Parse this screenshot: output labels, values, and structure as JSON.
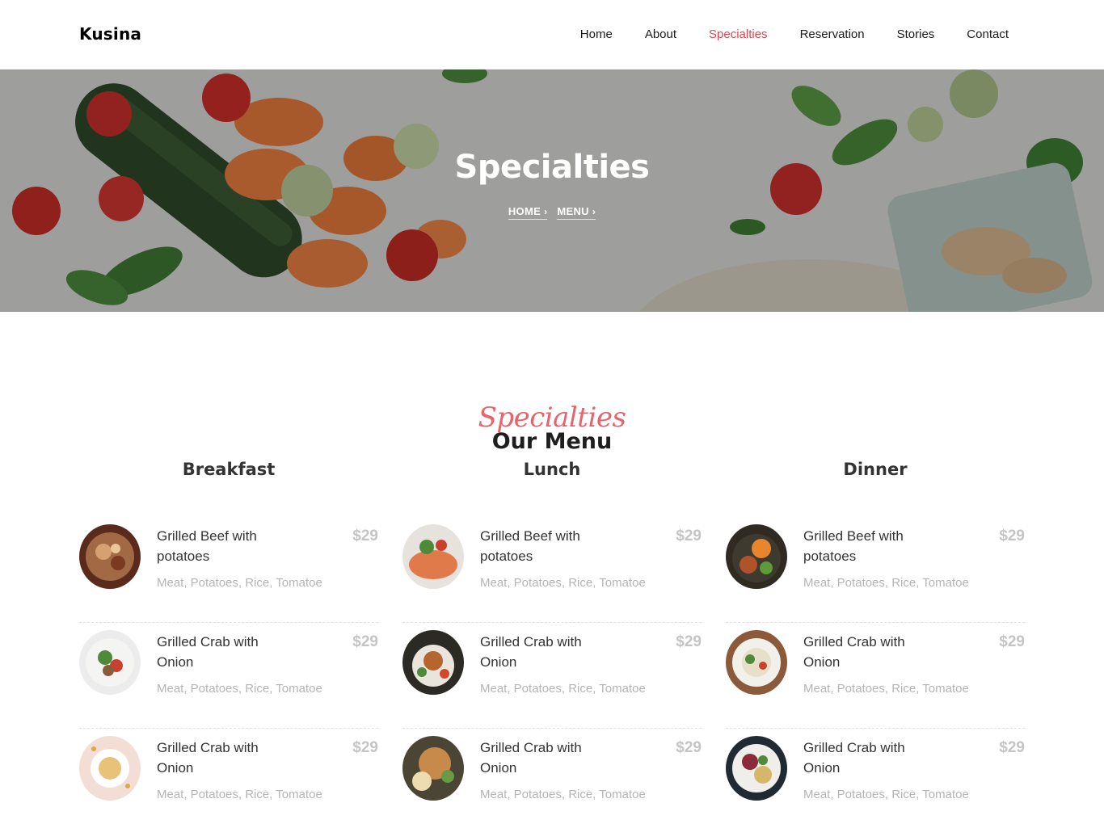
{
  "brand": "Kusina",
  "nav": {
    "items": [
      {
        "label": "Home"
      },
      {
        "label": "About"
      },
      {
        "label": "Specialties",
        "active": true
      },
      {
        "label": "Reservation"
      },
      {
        "label": "Stories"
      },
      {
        "label": "Contact"
      }
    ]
  },
  "hero": {
    "title": "Specialties",
    "breadcrumb": [
      "HOME",
      "MENU"
    ]
  },
  "section": {
    "script_label": "Specialties",
    "title": "Our Menu"
  },
  "columns": [
    {
      "title": "Breakfast",
      "items": [
        {
          "name": "Grilled Beef with potatoes",
          "price": "$29",
          "desc": "Meat, Potatoes, Rice, Tomatoe"
        },
        {
          "name": "Grilled Crab with Onion",
          "price": "$29",
          "desc": "Meat, Potatoes, Rice, Tomatoe"
        },
        {
          "name": "Grilled Crab with Onion",
          "price": "$29",
          "desc": "Meat, Potatoes, Rice, Tomatoe"
        }
      ]
    },
    {
      "title": "Lunch",
      "items": [
        {
          "name": "Grilled Beef with potatoes",
          "price": "$29",
          "desc": "Meat, Potatoes, Rice, Tomatoe"
        },
        {
          "name": "Grilled Crab with Onion",
          "price": "$29",
          "desc": "Meat, Potatoes, Rice, Tomatoe"
        },
        {
          "name": "Grilled Crab with Onion",
          "price": "$29",
          "desc": "Meat, Potatoes, Rice, Tomatoe"
        }
      ]
    },
    {
      "title": "Dinner",
      "items": [
        {
          "name": "Grilled Beef with potatoes",
          "price": "$29",
          "desc": "Meat, Potatoes, Rice, Tomatoe"
        },
        {
          "name": "Grilled Crab with Onion",
          "price": "$29",
          "desc": "Meat, Potatoes, Rice, Tomatoe"
        },
        {
          "name": "Grilled Crab with Onion",
          "price": "$29",
          "desc": "Meat, Potatoes, Rice, Tomatoe"
        }
      ]
    }
  ],
  "colors": {
    "accent": "#e0454f",
    "script": "#e8646c",
    "price": "#c4c4c4",
    "muted": "#b5b5b5"
  }
}
